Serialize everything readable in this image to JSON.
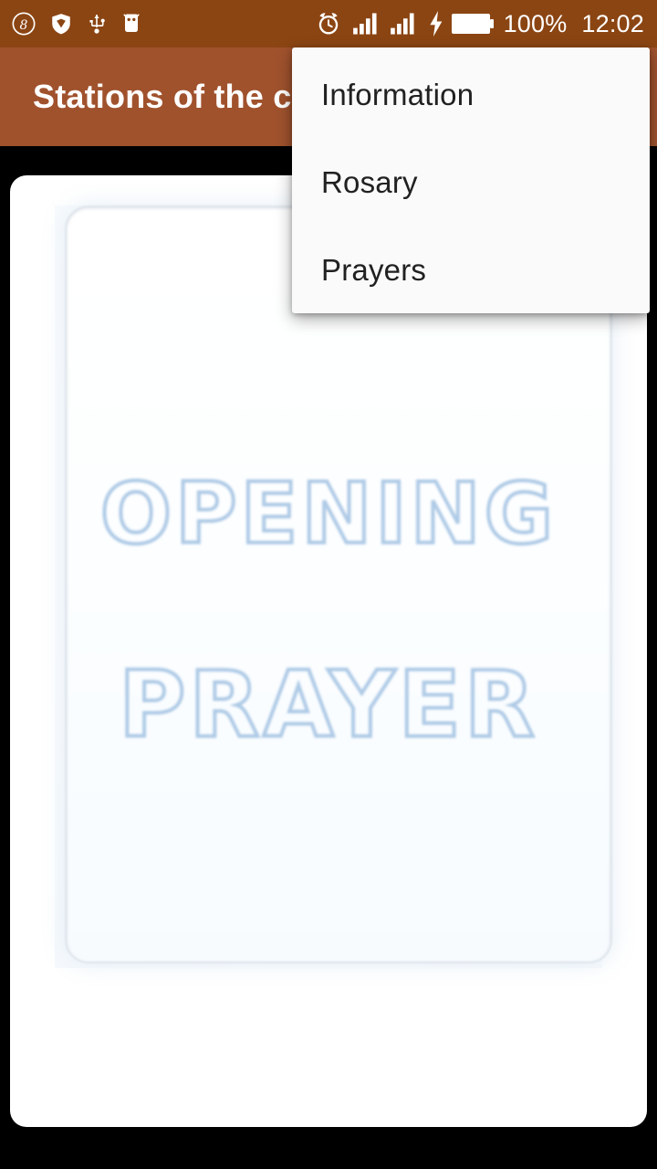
{
  "status_bar": {
    "background": "#8b4513",
    "left_icons": [
      {
        "name": "brightness-auto-icon",
        "glyph": "8"
      },
      {
        "name": "shield-security-icon",
        "glyph": "shield"
      },
      {
        "name": "usb-icon",
        "glyph": "usb"
      },
      {
        "name": "android-marshmallow-icon",
        "glyph": "android"
      }
    ],
    "right_icons": [
      {
        "name": "alarm-clock-icon",
        "glyph": "alarm"
      },
      {
        "name": "signal-sim1-icon",
        "glyph": "signal"
      },
      {
        "name": "signal-sim2-icon",
        "glyph": "signal"
      },
      {
        "name": "charging-bolt-icon",
        "glyph": "bolt"
      },
      {
        "name": "battery-full-icon",
        "glyph": "battery"
      }
    ],
    "battery_percent": "100%",
    "clock": "12:02"
  },
  "app_bar": {
    "background": "#a0522d",
    "title": "Stations of the cross",
    "title_visible": "Stations of the c"
  },
  "overflow_menu": {
    "visible": true,
    "background": "#fafafa",
    "items": [
      {
        "label": "Information",
        "name": "menu-item-information"
      },
      {
        "label": "Rosary",
        "name": "menu-item-rosary"
      },
      {
        "label": "Prayers",
        "name": "menu-item-prayers"
      }
    ]
  },
  "main": {
    "card": {
      "background": "#ffffff"
    },
    "prayer_image": {
      "line1": "OPENING",
      "line2": "PRAYER",
      "text_outline_color": "#a8c6e4"
    }
  }
}
